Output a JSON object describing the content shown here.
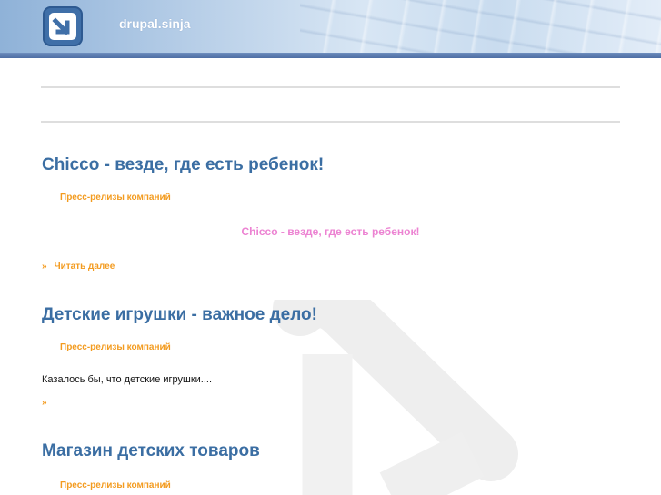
{
  "header": {
    "site_name": "drupal.sinja",
    "logo_icon": "arrow-down-right-icon"
  },
  "colors": {
    "title": "#3b6ea3",
    "term": "#f39b1f",
    "teaser_highlight": "#ec82d2",
    "header_strip": "#4e6ea4"
  },
  "nodes": [
    {
      "title": "Chicco - везде, где есть ребенок!",
      "term": "Пресс-релизы компаний",
      "teaser": "Chicco - везде, где есть ребенок!",
      "read_more_symbol": "»",
      "read_more_label": "Читать далее"
    },
    {
      "title": "Детские игрушки - важное дело!",
      "term": "Пресс-релизы компаний",
      "teaser": "Казалось бы, что детские игрушки....",
      "read_more_symbol": "»",
      "read_more_label": ""
    },
    {
      "title": "Магазин детских товаров",
      "term": "Пресс-релизы компаний"
    }
  ]
}
